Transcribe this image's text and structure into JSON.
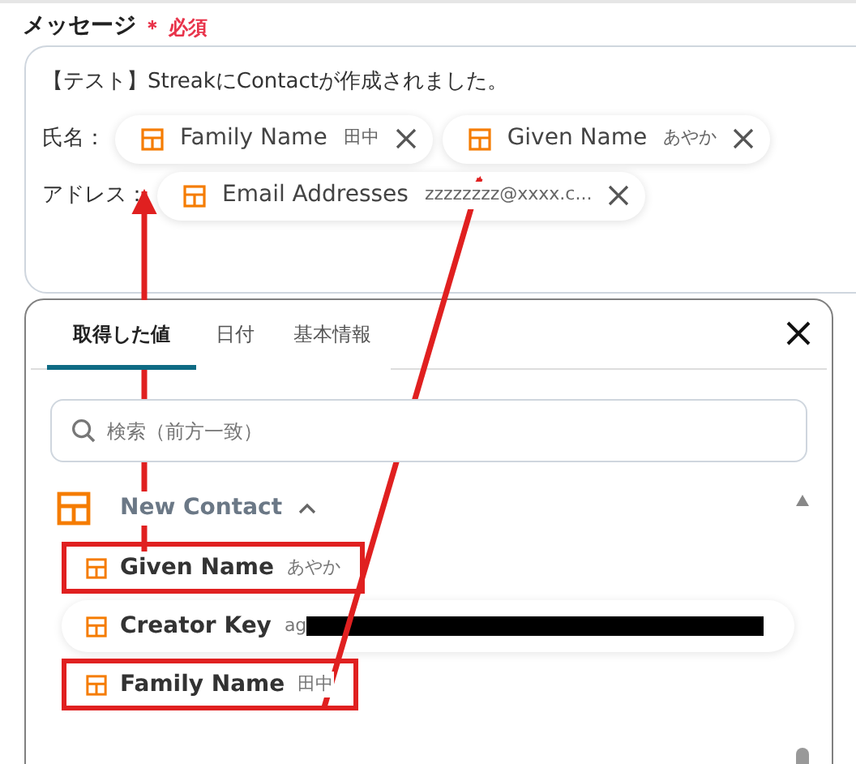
{
  "field": {
    "label": "メッセージ",
    "required_mark": "＊",
    "required_text": "必須"
  },
  "message": {
    "first_line": "【テスト】StreakにContactが作成されました。",
    "rows": [
      {
        "label": "氏名：",
        "chips": [
          {
            "label": "Family Name",
            "value": "田中"
          },
          {
            "label": "Given Name",
            "value": "あやか"
          }
        ]
      },
      {
        "label": "アドレス：",
        "chips": [
          {
            "label": "Email Addresses",
            "value": "zzzzzzzz@xxxx.c..."
          }
        ]
      }
    ]
  },
  "picker": {
    "tabs": [
      {
        "label": "取得した値",
        "selected": true
      },
      {
        "label": "日付",
        "selected": false
      },
      {
        "label": "基本情報",
        "selected": false
      }
    ],
    "search": {
      "placeholder": "検索（前方一致）"
    },
    "group": {
      "label": "New Contact",
      "expanded": true,
      "items": [
        {
          "label": "Given Name",
          "value": "あやか",
          "highlighted": true,
          "redacted": false
        },
        {
          "label": "Creator Key",
          "value": "ag",
          "highlighted": false,
          "redacted": true
        },
        {
          "label": "Family Name",
          "value": "田中",
          "highlighted": true,
          "redacted": false
        }
      ]
    }
  }
}
